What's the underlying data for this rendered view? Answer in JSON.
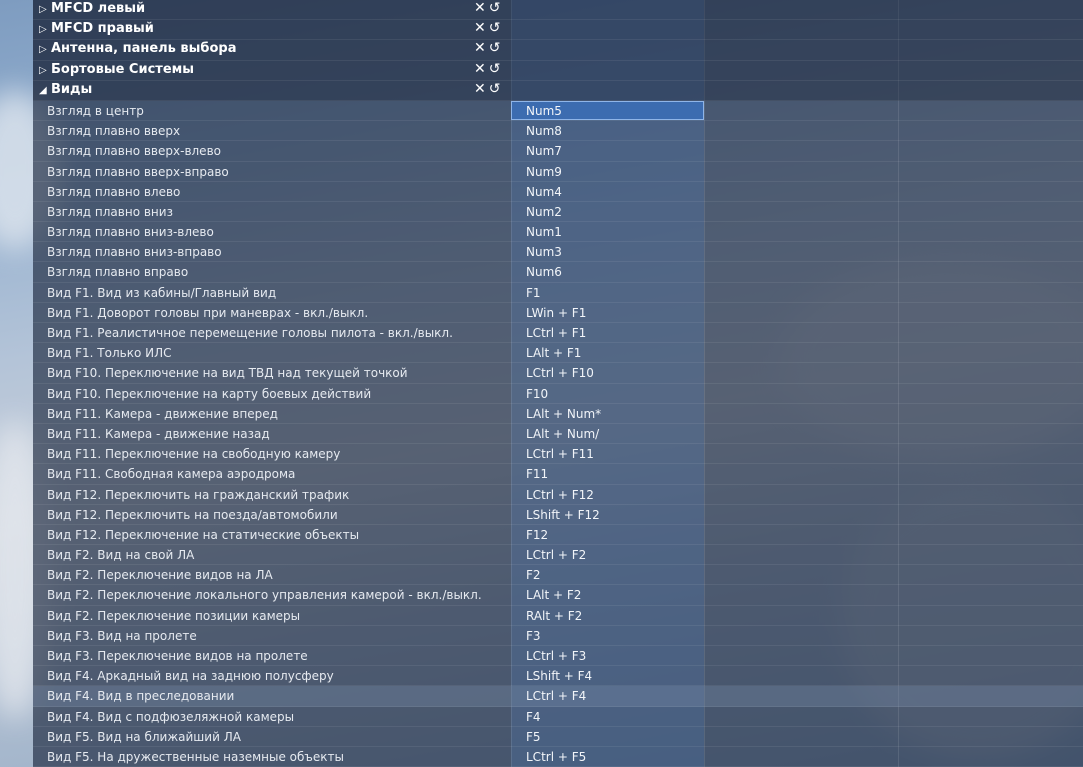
{
  "sections": [
    {
      "title": "MFCD левый",
      "expanded": false
    },
    {
      "title": "MFCD правый",
      "expanded": false
    },
    {
      "title": "Антенна, панель выбора",
      "expanded": false
    },
    {
      "title": "Бортовые Системы",
      "expanded": false
    },
    {
      "title": "Виды",
      "expanded": true
    }
  ],
  "section_icons": {
    "clear": "✕",
    "reset": "↺"
  },
  "bindings": [
    {
      "action": "Взгляд в центр",
      "key": "Num5"
    },
    {
      "action": "Взгляд плавно вверх",
      "key": "Num8"
    },
    {
      "action": "Взгляд плавно вверх-влево",
      "key": "Num7"
    },
    {
      "action": "Взгляд плавно вверх-вправо",
      "key": "Num9"
    },
    {
      "action": "Взгляд плавно влево",
      "key": "Num4"
    },
    {
      "action": "Взгляд плавно вниз",
      "key": "Num2"
    },
    {
      "action": "Взгляд плавно вниз-влево",
      "key": "Num1"
    },
    {
      "action": "Взгляд плавно вниз-вправо",
      "key": "Num3"
    },
    {
      "action": "Взгляд плавно вправо",
      "key": "Num6"
    },
    {
      "action": "Вид F1. Вид из кабины/Главный вид",
      "key": "F1"
    },
    {
      "action": "Вид F1. Доворот головы при маневрах - вкл./выкл.",
      "key": "LWin + F1"
    },
    {
      "action": "Вид F1. Реалистичное перемещение головы пилота - вкл./выкл.",
      "key": "LCtrl + F1"
    },
    {
      "action": "Вид F1. Только ИЛС",
      "key": "LAlt + F1"
    },
    {
      "action": "Вид F10. Переключение на вид ТВД над текущей точкой",
      "key": "LCtrl + F10"
    },
    {
      "action": "Вид F10. Переключение на карту боевых действий",
      "key": "F10"
    },
    {
      "action": "Вид F11. Камера - движение вперед",
      "key": "LAlt + Num*"
    },
    {
      "action": "Вид F11. Камера - движение назад",
      "key": "LAlt + Num/"
    },
    {
      "action": "Вид F11. Переключение на свободную камеру",
      "key": "LCtrl + F11"
    },
    {
      "action": "Вид F11. Свободная камера аэродрома",
      "key": "F11"
    },
    {
      "action": "Вид F12. Переключить на гражданский трафик",
      "key": "LCtrl + F12"
    },
    {
      "action": "Вид F12. Переключить на поезда/автомобили",
      "key": "LShift + F12"
    },
    {
      "action": "Вид F12. Переключение на статические объекты",
      "key": "F12"
    },
    {
      "action": "Вид F2. Вид на свой ЛА",
      "key": "LCtrl + F2"
    },
    {
      "action": "Вид F2. Переключение видов на ЛА",
      "key": "F2"
    },
    {
      "action": "Вид F2. Переключение локального управления камерой - вкл./выкл.",
      "key": "LAlt + F2"
    },
    {
      "action": "Вид F2. Переключение позиции камеры",
      "key": "RAlt + F2"
    },
    {
      "action": "Вид F3. Вид на пролете",
      "key": "F3"
    },
    {
      "action": "Вид F3. Переключение видов на пролете",
      "key": "LCtrl + F3"
    },
    {
      "action": "Вид F4. Аркадный вид на заднюю полусферу",
      "key": "LShift + F4"
    },
    {
      "action": "Вид F4. Вид в преследовании",
      "key": "LCtrl + F4"
    },
    {
      "action": "Вид F4. Вид с подфюзеляжной камеры",
      "key": "F4"
    },
    {
      "action": "Вид F5. Вид на ближайший ЛА",
      "key": "F5"
    },
    {
      "action": "Вид F5. На дружественные наземные объекты",
      "key": "LCtrl + F5"
    }
  ],
  "selected_index": 0,
  "hover_index": 29,
  "colors": {
    "accent": "#3c6cb0",
    "panel": "#1c283e"
  }
}
